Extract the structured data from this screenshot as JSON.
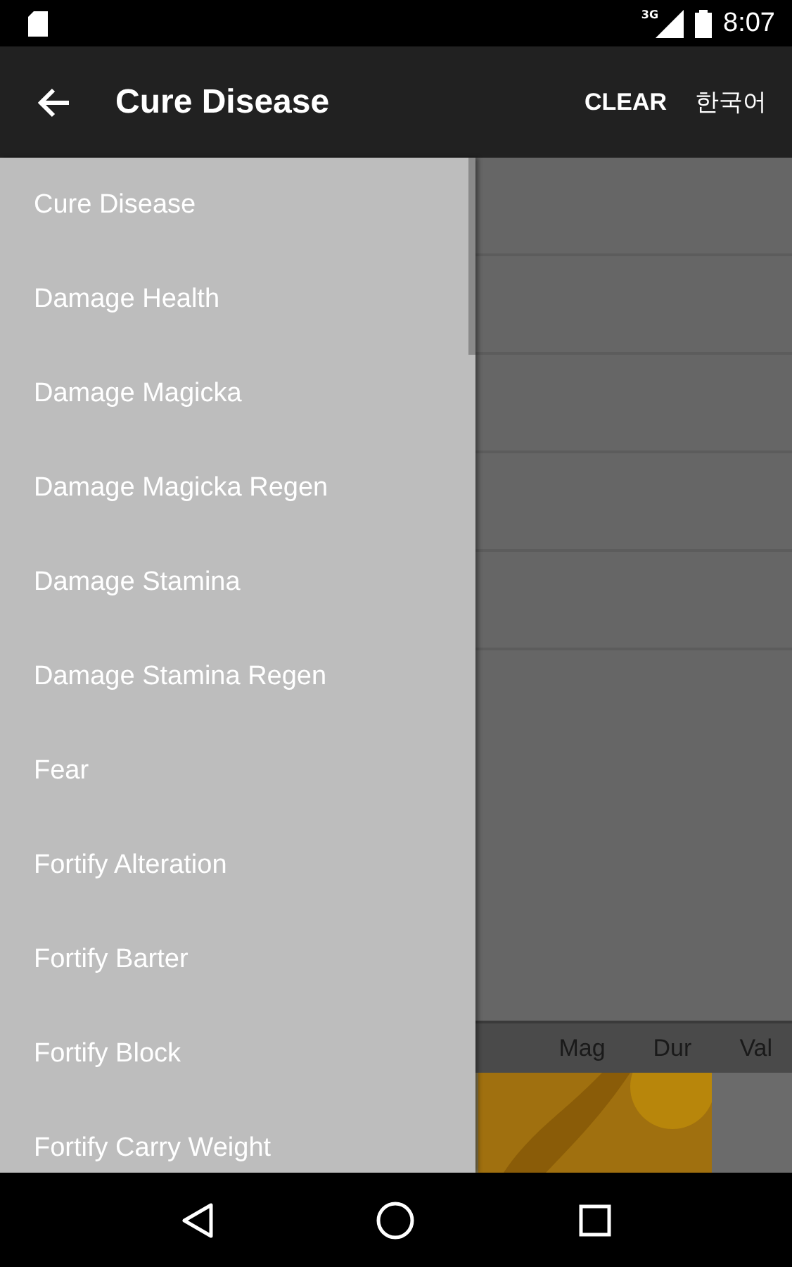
{
  "status_bar": {
    "time": "8:07",
    "network": "3G"
  },
  "app_bar": {
    "title": "Cure Disease",
    "actions": [
      {
        "label": "CLEAR"
      },
      {
        "label": "한국어"
      }
    ]
  },
  "table": {
    "columns": [
      {
        "label": "Mag"
      },
      {
        "label": "Dur"
      },
      {
        "label": "Val"
      }
    ]
  },
  "drawer": {
    "items": [
      {
        "label": "Cure Disease"
      },
      {
        "label": "Damage Health"
      },
      {
        "label": "Damage Magicka"
      },
      {
        "label": "Damage Magicka Regen"
      },
      {
        "label": "Damage Stamina"
      },
      {
        "label": "Damage Stamina Regen"
      },
      {
        "label": "Fear"
      },
      {
        "label": "Fortify Alteration"
      },
      {
        "label": "Fortify Barter"
      },
      {
        "label": "Fortify Block"
      },
      {
        "label": "Fortify Carry Weight"
      }
    ]
  }
}
